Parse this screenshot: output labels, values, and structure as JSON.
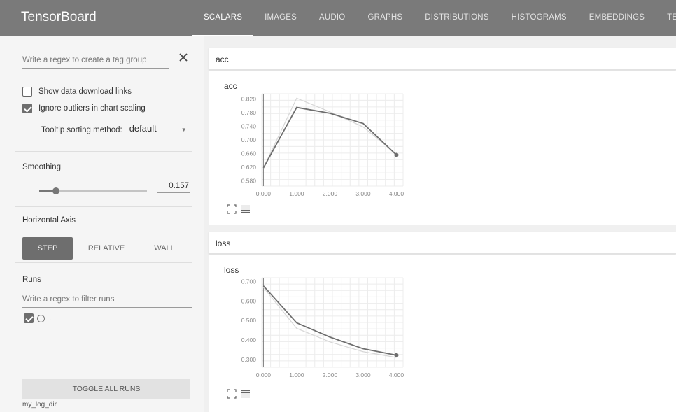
{
  "header": {
    "brand": "TensorBoard",
    "tabs": [
      {
        "label": "SCALARS",
        "active": true
      },
      {
        "label": "IMAGES",
        "active": false
      },
      {
        "label": "AUDIO",
        "active": false
      },
      {
        "label": "GRAPHS",
        "active": false
      },
      {
        "label": "DISTRIBUTIONS",
        "active": false
      },
      {
        "label": "HISTOGRAMS",
        "active": false
      },
      {
        "label": "EMBEDDINGS",
        "active": false
      },
      {
        "label": "TEXT",
        "active": false
      }
    ]
  },
  "sidebar": {
    "tag_regex_placeholder": "Write a regex to create a tag group",
    "show_download_label": "Show data download links",
    "show_download_checked": false,
    "ignore_outliers_label": "Ignore outliers in chart scaling",
    "ignore_outliers_checked": true,
    "tooltip_sort_label": "Tooltip sorting method:",
    "tooltip_sort_value": "default",
    "smoothing_label": "Smoothing",
    "smoothing_value": "0.157",
    "smoothing_fraction": 0.157,
    "horizontal_axis_label": "Horizontal Axis",
    "axis_options": [
      {
        "label": "STEP",
        "active": true
      },
      {
        "label": "RELATIVE",
        "active": false
      },
      {
        "label": "WALL",
        "active": false
      }
    ],
    "runs_label": "Runs",
    "runs_filter_placeholder": "Write a regex to filter runs",
    "run_name": ".",
    "run_checked": true,
    "toggle_all_label": "TOGGLE ALL RUNS",
    "log_dir": "my_log_dir"
  },
  "main": {
    "panes": [
      {
        "header": "acc",
        "chart_title": "acc"
      },
      {
        "header": "loss",
        "chart_title": "loss"
      }
    ]
  },
  "colors": {
    "header_bg": "#7a7a7a",
    "smoothed_line": "#6e6e6e",
    "raw_line": "#d6d6d6"
  },
  "icons": [
    "close-icon",
    "checkbox-icon",
    "dropdown-arrow-icon",
    "radio-icon",
    "fit-to-data-icon",
    "toggle-data-table-icon"
  ],
  "chart_data": [
    {
      "type": "line",
      "title": "acc",
      "x": [
        0,
        1,
        2,
        3,
        4
      ],
      "xticks": [
        "0.000",
        "1.000",
        "2.000",
        "3.000",
        "4.000"
      ],
      "yticks": [
        "0.580",
        "0.620",
        "0.660",
        "0.700",
        "0.740",
        "0.780",
        "0.820"
      ],
      "ylim": [
        0.565,
        0.835
      ],
      "xlim": [
        -0.05,
        4.2
      ],
      "series": [
        {
          "role": "raw",
          "values": [
            0.618,
            0.822,
            0.782,
            0.738,
            0.658
          ]
        },
        {
          "role": "smoothed",
          "values": [
            0.618,
            0.795,
            0.778,
            0.748,
            0.656
          ]
        }
      ],
      "grid": true
    },
    {
      "type": "line",
      "title": "loss",
      "x": [
        0,
        1,
        2,
        3,
        4
      ],
      "xticks": [
        "0.000",
        "1.000",
        "2.000",
        "3.000",
        "4.000"
      ],
      "yticks": [
        "0.300",
        "0.400",
        "0.500",
        "0.600",
        "0.700"
      ],
      "ylim": [
        0.26,
        0.72
      ],
      "xlim": [
        -0.05,
        4.2
      ],
      "series": [
        {
          "role": "raw",
          "values": [
            0.67,
            0.46,
            0.39,
            0.34,
            0.31
          ]
        },
        {
          "role": "smoothed",
          "values": [
            0.678,
            0.488,
            0.415,
            0.355,
            0.322
          ]
        }
      ],
      "grid": true
    }
  ]
}
